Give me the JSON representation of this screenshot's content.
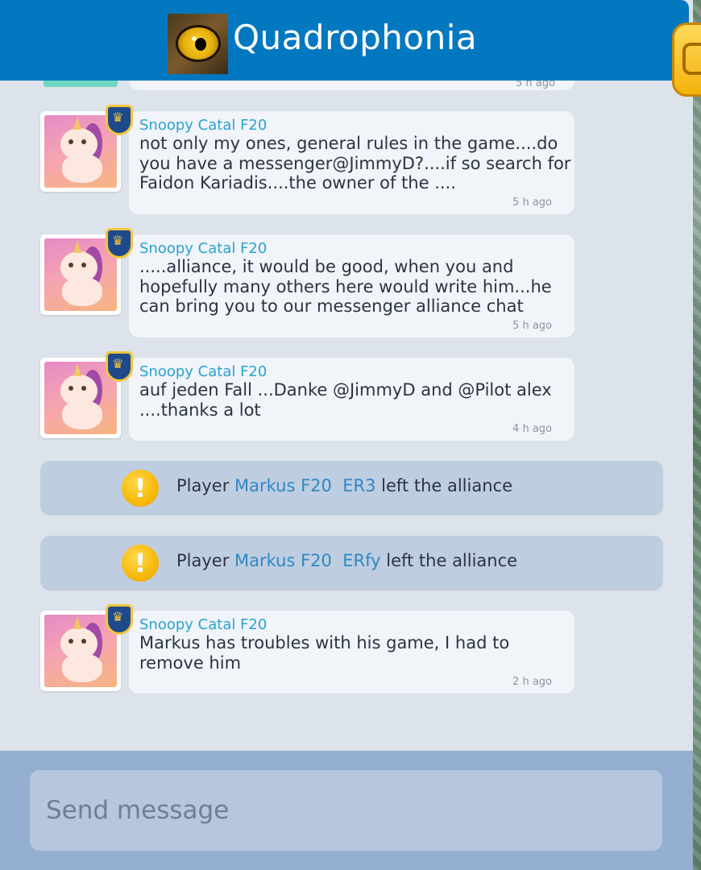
{
  "header": {
    "title": "Quadrophonia",
    "logo_icon": "owl-eye-icon"
  },
  "side_tab": {
    "icon": "chat-bubble-icon",
    "color": "#f4b30d"
  },
  "messages": [
    {
      "type": "partial",
      "time": "5 h ago"
    },
    {
      "type": "chat",
      "sender": "Snoopy Catal F20",
      "lines": [
        "not only my ones, general rules in the game....do",
        "you have a messenger@JimmyD?....if so search for",
        "Faidon Kariadis....the owner of the ...."
      ],
      "time": "5 h ago"
    },
    {
      "type": "chat",
      "sender": "Snoopy Catal F20",
      "lines": [
        ".....alliance, it would be good, when you and",
        "hopefully many others here would write him...he",
        "can bring you to our messenger alliance chat"
      ],
      "time": "5 h ago"
    },
    {
      "type": "chat",
      "sender": "Snoopy Catal F20",
      "lines": [
        "auf jeden Fall ...Danke @JimmyD and @Pilot alex",
        "....thanks a lot"
      ],
      "time": "4 h ago"
    },
    {
      "type": "notice",
      "prefix": "Player ",
      "player": "Markus F20  ER3",
      "suffix": " left the alliance"
    },
    {
      "type": "notice",
      "prefix": "Player ",
      "player": "Markus F20  ERfy",
      "suffix": " left the alliance"
    },
    {
      "type": "chat",
      "sender": "Snoopy Catal F20",
      "lines": [
        "Markus has troubles with his game, I had to",
        "remove him"
      ],
      "time": "2 h ago"
    }
  ],
  "composer": {
    "placeholder": "Send message"
  },
  "colors": {
    "header_bg": "#0278c0",
    "sender_name": "#28a3d2",
    "player_link": "#2e88c4",
    "bubble_bg": "#f1f4f8",
    "notice_bg": "#bfcde0",
    "footer_bg": "#94afd1"
  }
}
